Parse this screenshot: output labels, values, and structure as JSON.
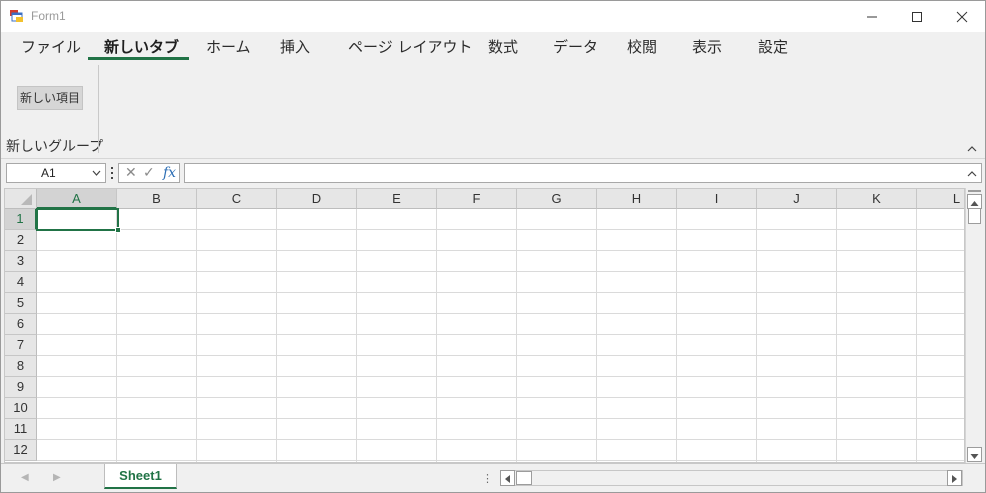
{
  "window": {
    "title": "Form1"
  },
  "ribbon": {
    "tabs": [
      {
        "label": "ファイル"
      },
      {
        "label": "新しいタブ",
        "active": true
      },
      {
        "label": "ホーム"
      },
      {
        "label": "挿入"
      },
      {
        "label": "ページ レイアウト"
      },
      {
        "label": "数式"
      },
      {
        "label": "データ"
      },
      {
        "label": "校閲"
      },
      {
        "label": "表示"
      },
      {
        "label": "設定"
      }
    ],
    "group": {
      "label": "新しいグループ",
      "button_label": "新しい項目"
    }
  },
  "formula_bar": {
    "name_box": "A1",
    "cancel_icon": "✕",
    "enter_icon": "✓",
    "function_icon": "fx",
    "formula": ""
  },
  "grid": {
    "columns": [
      "A",
      "B",
      "C",
      "D",
      "E",
      "F",
      "G",
      "H",
      "I",
      "J",
      "K",
      "L"
    ],
    "rows": [
      "1",
      "2",
      "3",
      "4",
      "5",
      "6",
      "7",
      "8",
      "9",
      "10",
      "11",
      "12"
    ],
    "active_cell": "A1"
  },
  "sheets": [
    {
      "name": "Sheet1",
      "active": true
    }
  ],
  "colors": {
    "accent": "#217346"
  }
}
